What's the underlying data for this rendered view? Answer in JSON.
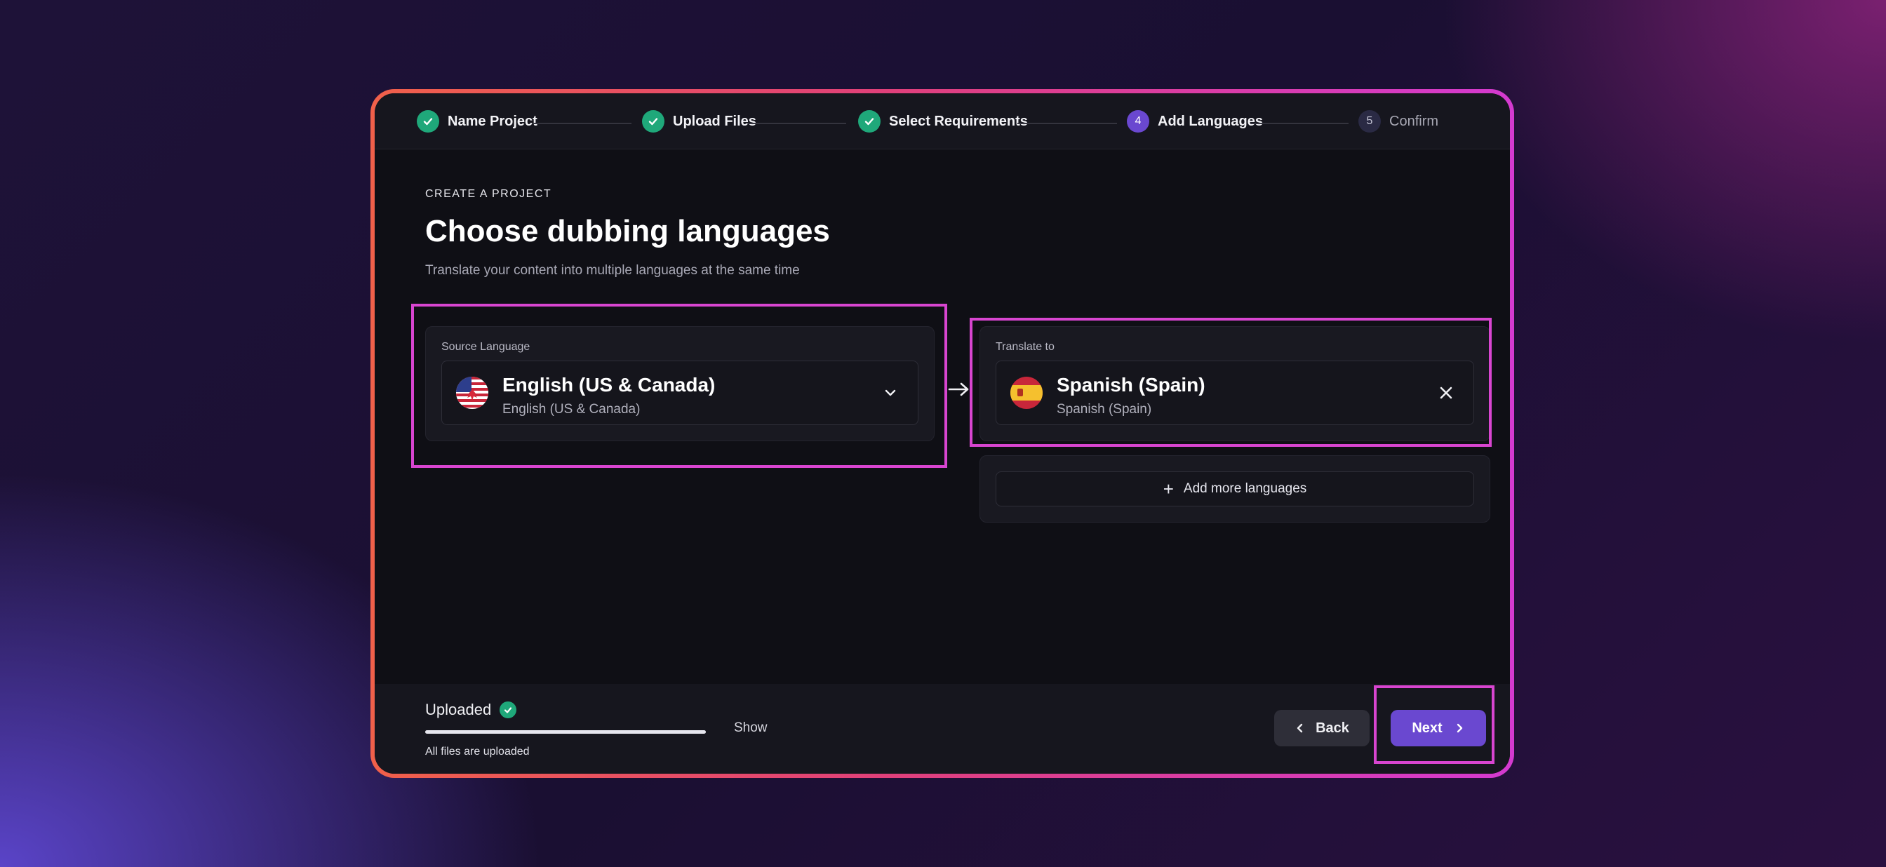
{
  "stepper": {
    "steps": [
      {
        "label": "Name Project",
        "state": "done",
        "icon": "check-icon"
      },
      {
        "label": "Upload Files",
        "state": "done",
        "icon": "check-icon"
      },
      {
        "label": "Select Requirements",
        "state": "done",
        "icon": "check-icon"
      },
      {
        "label": "Add Languages",
        "state": "active",
        "number": "4"
      },
      {
        "label": "Confirm",
        "state": "pending",
        "number": "5"
      }
    ]
  },
  "header": {
    "eyebrow": "CREATE A PROJECT",
    "title": "Choose dubbing languages",
    "subtitle": "Translate your content into multiple languages at the same time"
  },
  "source": {
    "label": "Source Language",
    "language": "English (US & Canada)",
    "sublabel": "English (US & Canada)",
    "flag_icon": "us-canada-flag-icon"
  },
  "target": {
    "label": "Translate to",
    "language": "Spanish (Spain)",
    "sublabel": "Spanish (Spain)",
    "flag_icon": "spain-flag-icon"
  },
  "add_more": {
    "label": "Add more languages"
  },
  "footer": {
    "status": "Uploaded",
    "progress": 1.0,
    "show_label": "Show",
    "note": "All files are uploaded",
    "back_label": "Back",
    "next_label": "Next"
  },
  "colors": {
    "accent": "#6a48d0",
    "success": "#1fa87a",
    "highlight": "#d845d0",
    "frame_start": "#f0604a",
    "frame_end": "#d43ad0"
  }
}
